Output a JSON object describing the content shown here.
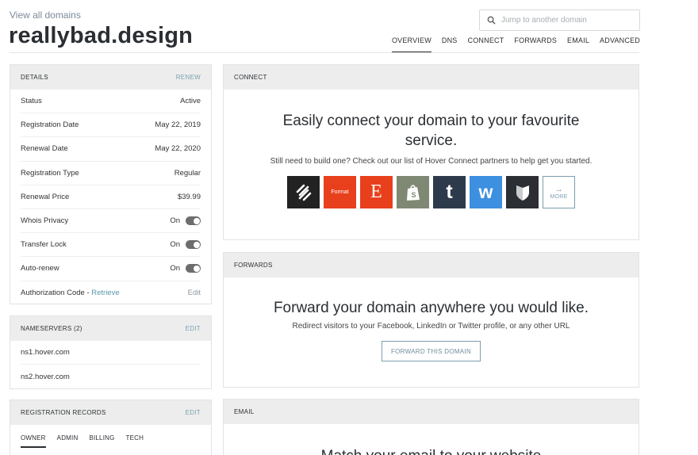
{
  "header": {
    "back_link": "View all domains",
    "domain": "reallybad.design",
    "search_placeholder": "Jump to another domain",
    "tabs": [
      "OVERVIEW",
      "DNS",
      "CONNECT",
      "FORWARDS",
      "EMAIL",
      "ADVANCED"
    ],
    "active_tab": "OVERVIEW"
  },
  "details": {
    "title": "DETAILS",
    "action": "RENEW",
    "rows": [
      {
        "label": "Status",
        "value": "Active"
      },
      {
        "label": "Registration Date",
        "value": "May 22, 2019"
      },
      {
        "label": "Renewal Date",
        "value": "May 22, 2020"
      },
      {
        "label": "Registration Type",
        "value": "Regular"
      },
      {
        "label": "Renewal Price",
        "value": "$39.99"
      },
      {
        "label": "Whois Privacy",
        "value": "On",
        "toggle": true
      },
      {
        "label": "Transfer Lock",
        "value": "On",
        "toggle": true
      },
      {
        "label": "Auto-renew",
        "value": "On",
        "toggle": true
      }
    ],
    "auth_code": {
      "label": "Authorization Code - ",
      "link": "Retrieve",
      "action": "Edit"
    }
  },
  "nameservers": {
    "title": "NAMESERVERS (2)",
    "action": "EDIT",
    "items": [
      "ns1.hover.com",
      "ns2.hover.com"
    ]
  },
  "registration_records": {
    "title": "REGISTRATION RECORDS",
    "action": "EDIT",
    "tabs": [
      "OWNER",
      "ADMIN",
      "BILLING",
      "TECH"
    ],
    "active_tab": "OWNER"
  },
  "connect": {
    "title": "CONNECT",
    "heading": "Easily connect your domain to your favourite service.",
    "subheading": "Still need to build one? Check out our list of Hover Connect partners to help get you started.",
    "partners": [
      {
        "name": "squarespace-logo-icon",
        "color": "#222222",
        "glyph": ""
      },
      {
        "name": "format-logo-icon",
        "color": "#e8401c",
        "glyph": "Format"
      },
      {
        "name": "etsy-logo-icon",
        "color": "#e8401c",
        "glyph": "E"
      },
      {
        "name": "shopify-logo-icon",
        "color": "#7f8873",
        "glyph": ""
      },
      {
        "name": "tumblr-logo-icon",
        "color": "#2d3a4c",
        "glyph": "t"
      },
      {
        "name": "weebly-logo-icon",
        "color": "#3d8fe0",
        "glyph": "w"
      },
      {
        "name": "bandcamp-shield-logo-icon",
        "color": "#2b2f33",
        "glyph": ""
      }
    ],
    "more_label": "MORE",
    "more_arrow": "→"
  },
  "forwards": {
    "title": "FORWARDS",
    "heading": "Forward your domain anywhere you would like.",
    "subheading": "Redirect visitors to your Facebook, LinkedIn or Twitter profile, or any other URL",
    "button": "FORWARD THIS DOMAIN"
  },
  "email": {
    "title": "EMAIL",
    "heading": "Match your email to your website"
  },
  "colors": {
    "accent": "#7c9fae",
    "link": "#5a9aa8",
    "panel_header": "#ededed"
  }
}
